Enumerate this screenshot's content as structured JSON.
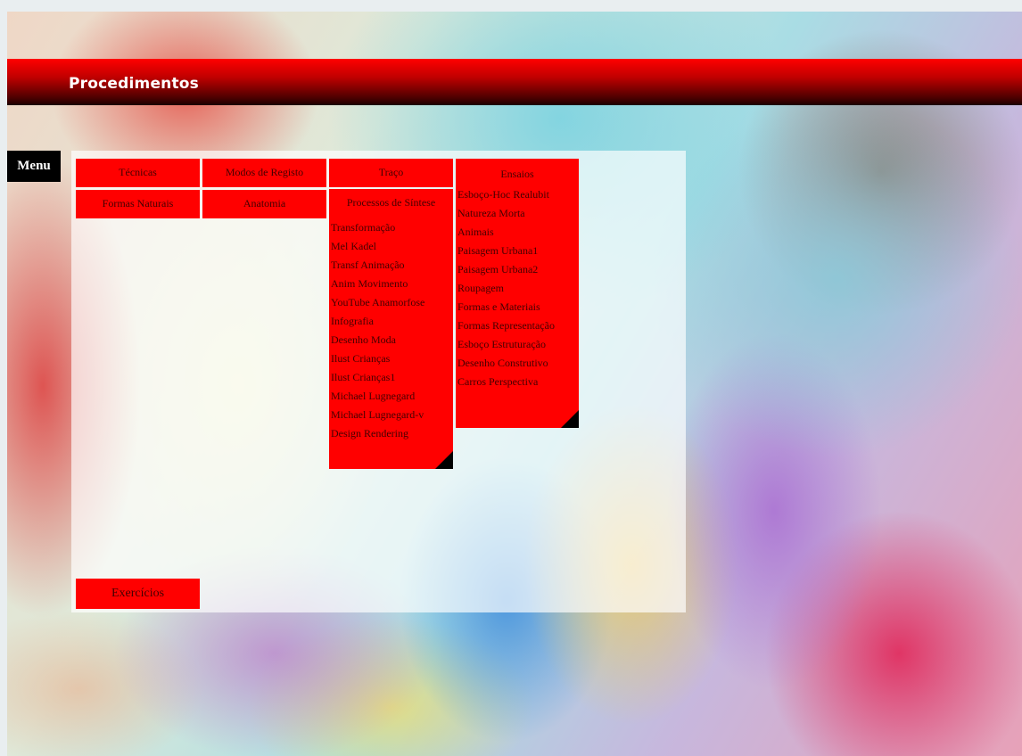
{
  "header": {
    "title": "Procedimentos"
  },
  "menu": {
    "label": "Menu"
  },
  "colors": {
    "accent": "#ff0000",
    "bar_dark": "#1a0000",
    "menu_bg": "#000000",
    "text_on_red": "#440000"
  },
  "buttons": {
    "tecnicas": "Técnicas",
    "modos_registo": "Modos de Registo",
    "traco": "Traço",
    "formas_naturais": "Formas Naturais",
    "anatomia": "Anatomia",
    "exercicios": "Exercícios"
  },
  "processos": {
    "header": "Processos de Síntese",
    "items": [
      "Transformação",
      "Mel Kadel",
      "Transf Animação",
      "Anim Movimento",
      "YouTube Anamorfose",
      "Infografia",
      "Desenho Moda",
      "Ilust Crianças",
      "Ilust Crianças1",
      "Michael Lugnegard",
      "Michael Lugnegard-v",
      "Design Rendering"
    ]
  },
  "ensaios": {
    "header": "Ensaios",
    "items": [
      "Esboço-Hoc Realubit",
      "Natureza Morta",
      "Animais",
      "Paisagem Urbana1",
      "Paisagem Urbana2",
      "Roupagem",
      "Formas e Materiais",
      "Formas Representação",
      "Esboço Estruturação",
      "Desenho Construtivo",
      "Carros Perspectiva"
    ]
  }
}
